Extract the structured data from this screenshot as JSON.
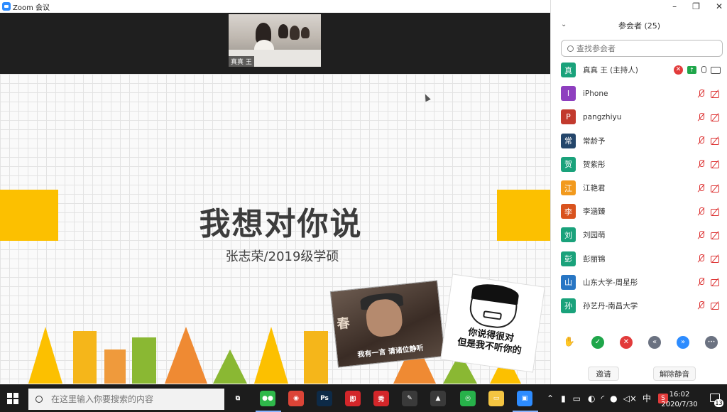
{
  "window": {
    "title": "Zoom 会议",
    "controls": [
      "–",
      "❐",
      "✕"
    ]
  },
  "video": {
    "participant_name": "真真 王"
  },
  "slide": {
    "title": "我想对你说",
    "subtitle": "张志荣/2019级学硕",
    "meme_left_caption": "我有一言 请诸位静听",
    "meme_left_sign": "春",
    "meme_right_caption_line1": "你说得很对",
    "meme_right_caption_line2": "但是我不听你的",
    "colors": {
      "yellow": "#fcc000",
      "orange": "#ef8a33",
      "green": "#8ab833",
      "gold": "#f5b61a"
    }
  },
  "panel": {
    "title": "参会者 (25)",
    "search_placeholder": "查找参会者",
    "participants": [
      {
        "initial": "真",
        "name": "真真 王 (主持人)",
        "color": "#1aa27b",
        "host": true
      },
      {
        "initial": "I",
        "name": "iPhone",
        "color": "#8e3fbf",
        "host": false
      },
      {
        "initial": "P",
        "name": "pangzhiyu",
        "color": "#c23a2e",
        "host": false
      },
      {
        "initial": "常",
        "name": "常龄予",
        "color": "#24466b",
        "host": false
      },
      {
        "initial": "贺",
        "name": "贺紫彤",
        "color": "#1aa27b",
        "host": false
      },
      {
        "initial": "江",
        "name": "江艳君",
        "color": "#f29a1e",
        "host": false
      },
      {
        "initial": "李",
        "name": "李涵臻",
        "color": "#d9531e",
        "host": false
      },
      {
        "initial": "刘",
        "name": "刘园萌",
        "color": "#1aa27b",
        "host": false
      },
      {
        "initial": "彭",
        "name": "彭丽锦",
        "color": "#1aa27b",
        "host": false
      },
      {
        "initial": "山",
        "name": "山东大学-周星彤",
        "color": "#2876c4",
        "host": false
      },
      {
        "initial": "孙",
        "name": "孙艺丹-南昌大学",
        "color": "#1aa27b",
        "host": false
      }
    ],
    "actions": {
      "raise_hand": "✋",
      "yes": "✓",
      "no": "✕",
      "slower": "«",
      "faster": "»",
      "more": "•••"
    },
    "invite_label": "邀请",
    "unmute_all_label": "解除静音"
  },
  "taskbar": {
    "search_placeholder": "在这里输入你要搜索的内容",
    "apps": [
      {
        "name": "task-view",
        "label": "⧉",
        "color": "transparent"
      },
      {
        "name": "wechat",
        "label": "●●",
        "color": "#2fb84a"
      },
      {
        "name": "chrome",
        "label": "◉",
        "color": "#db4437"
      },
      {
        "name": "photoshop",
        "label": "Ps",
        "color": "#0d2a47"
      },
      {
        "name": "app-red-1",
        "label": "即",
        "color": "#d3262a"
      },
      {
        "name": "app-red-2",
        "label": "秀",
        "color": "#d3262a"
      },
      {
        "name": "pen-app",
        "label": "✎",
        "color": "#3a3a3a"
      },
      {
        "name": "drive",
        "label": "▲",
        "color": "#3a3a3a"
      },
      {
        "name": "ring-app",
        "label": "◎",
        "color": "#27b14a"
      },
      {
        "name": "file-explorer",
        "label": "▭",
        "color": "#f4c542"
      },
      {
        "name": "zoom",
        "label": "▣",
        "color": "#2d8cff"
      }
    ],
    "tray": {
      "ime": "中",
      "sogou": "S",
      "time": "16:02",
      "date": "2020/7/30",
      "notifications": "13"
    }
  }
}
